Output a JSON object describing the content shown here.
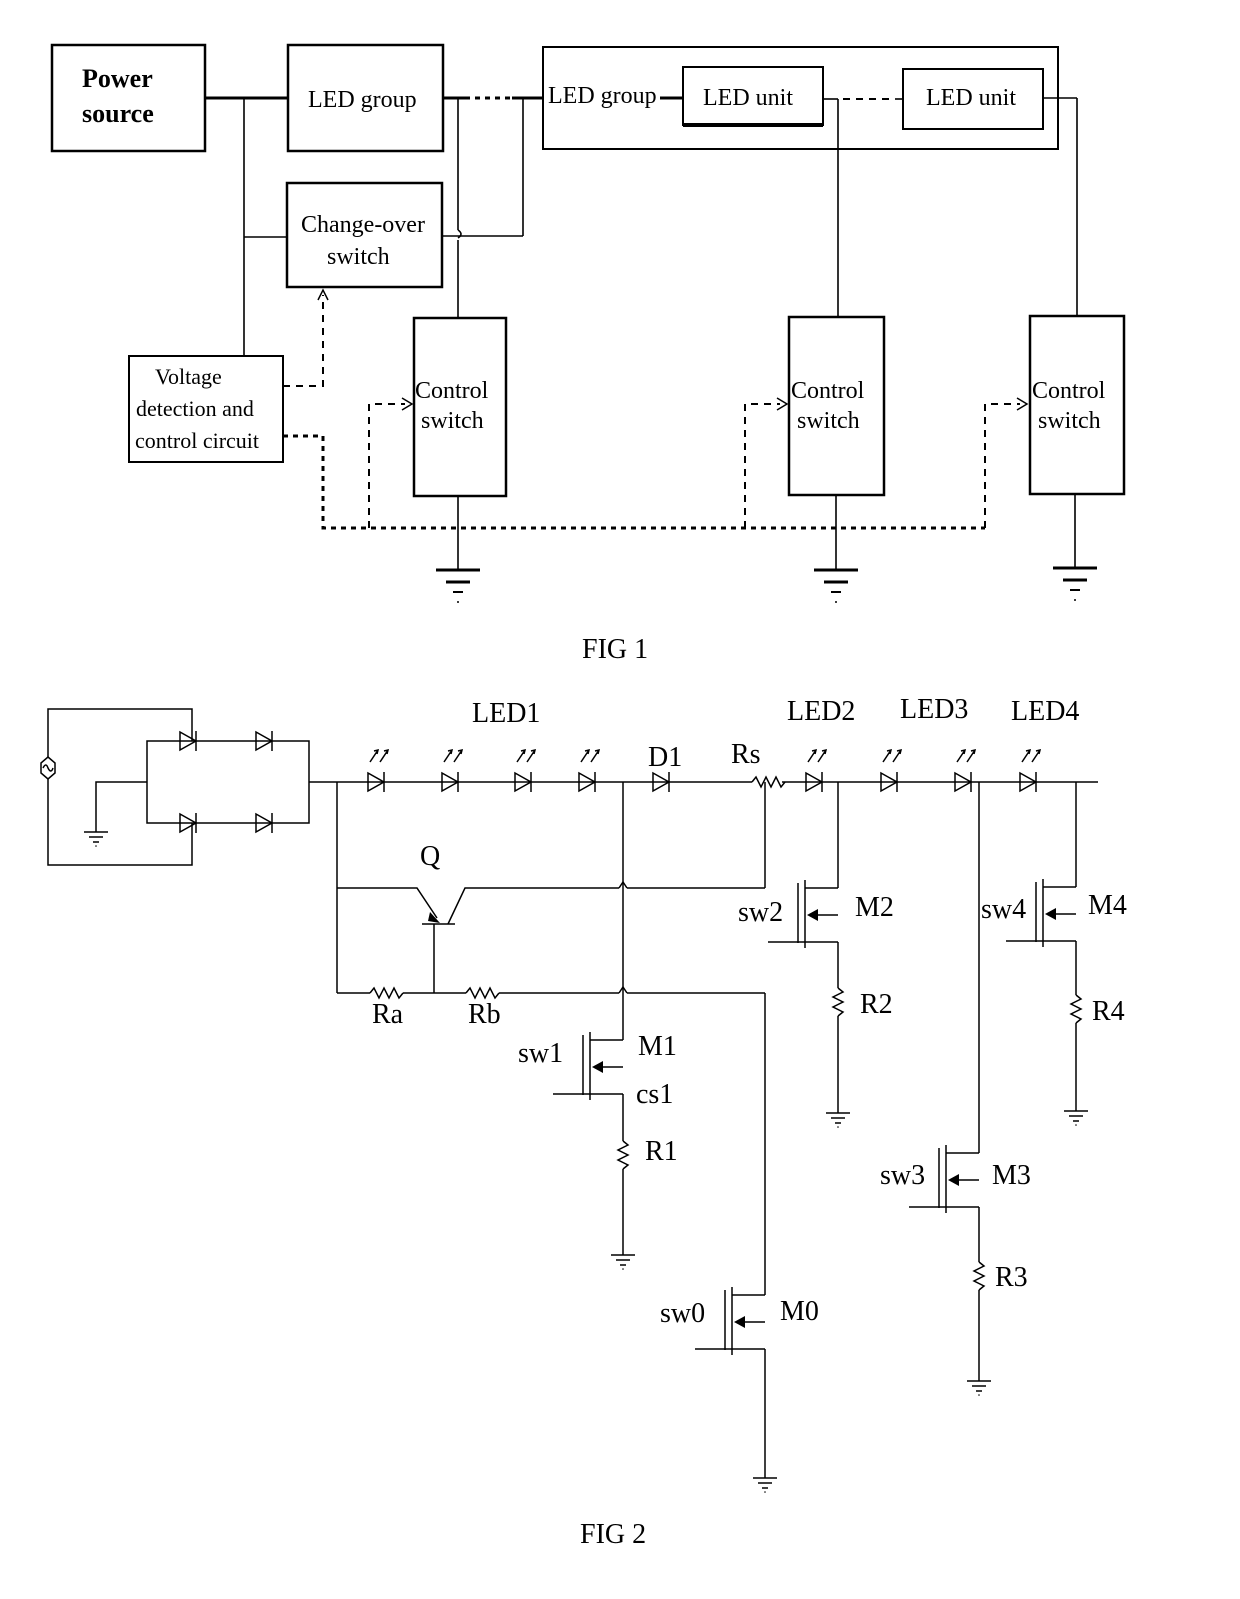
{
  "fig1": {
    "caption": "FIG 1",
    "power_source": [
      "Power",
      "source"
    ],
    "led_group_1": "LED group",
    "led_group_2": "LED group",
    "led_unit_1": "LED unit",
    "led_unit_2": "LED unit",
    "changeover_switch": [
      "Change-over",
      "switch"
    ],
    "voltage_detection": [
      "Voltage",
      "detection and",
      "control circuit"
    ],
    "control_switches": [
      [
        "Control",
        "switch"
      ],
      [
        "Control",
        "switch"
      ],
      [
        "Control",
        "switch"
      ]
    ]
  },
  "fig2": {
    "caption": "FIG 2",
    "led_labels": [
      "LED1",
      "LED2",
      "LED3",
      "LED4"
    ],
    "d1": "D1",
    "rs": "Rs",
    "q": "Q",
    "ra": "Ra",
    "rb": "Rb",
    "cs1": "cs1",
    "switches": [
      {
        "sw": "sw0",
        "m": "M0"
      },
      {
        "sw": "sw1",
        "m": "M1",
        "r": "R1"
      },
      {
        "sw": "sw2",
        "m": "M2",
        "r": "R2"
      },
      {
        "sw": "sw3",
        "m": "M3",
        "r": "R3"
      },
      {
        "sw": "sw4",
        "m": "M4",
        "r": "R4"
      }
    ]
  }
}
